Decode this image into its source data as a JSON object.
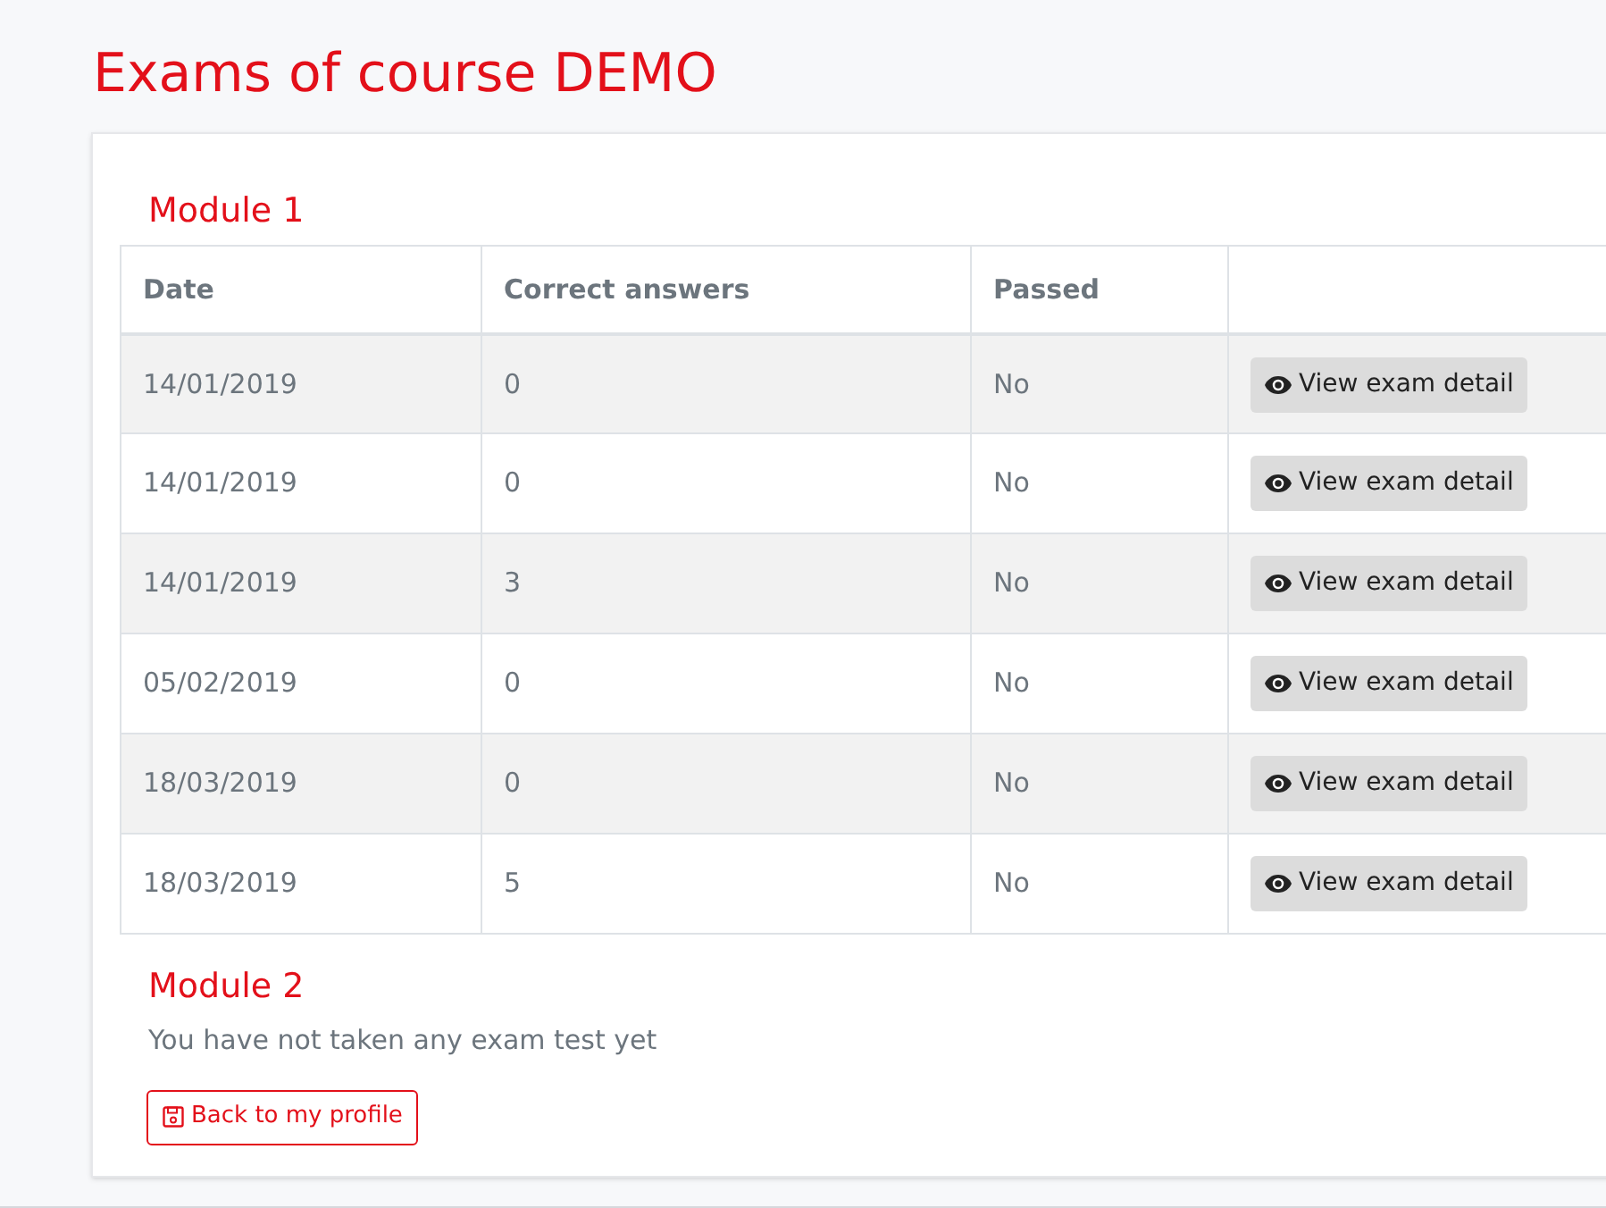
{
  "title": "Exams of course DEMO",
  "modules": [
    {
      "heading": "Module 1",
      "table": {
        "columns": [
          "Date",
          "Correct answers",
          "Passed"
        ],
        "rows": [
          {
            "date": "14/01/2019",
            "correct": "0",
            "passed": "No",
            "action": "View exam detail"
          },
          {
            "date": "14/01/2019",
            "correct": "0",
            "passed": "No",
            "action": "View exam detail"
          },
          {
            "date": "14/01/2019",
            "correct": "3",
            "passed": "No",
            "action": "View exam detail"
          },
          {
            "date": "05/02/2019",
            "correct": "0",
            "passed": "No",
            "action": "View exam detail"
          },
          {
            "date": "18/03/2019",
            "correct": "0",
            "passed": "No",
            "action": "View exam detail"
          },
          {
            "date": "18/03/2019",
            "correct": "5",
            "passed": "No",
            "action": "View exam detail"
          }
        ]
      }
    },
    {
      "heading": "Module 2",
      "message": "You have not taken any exam test yet"
    }
  ],
  "back_button": "Back to my profile"
}
